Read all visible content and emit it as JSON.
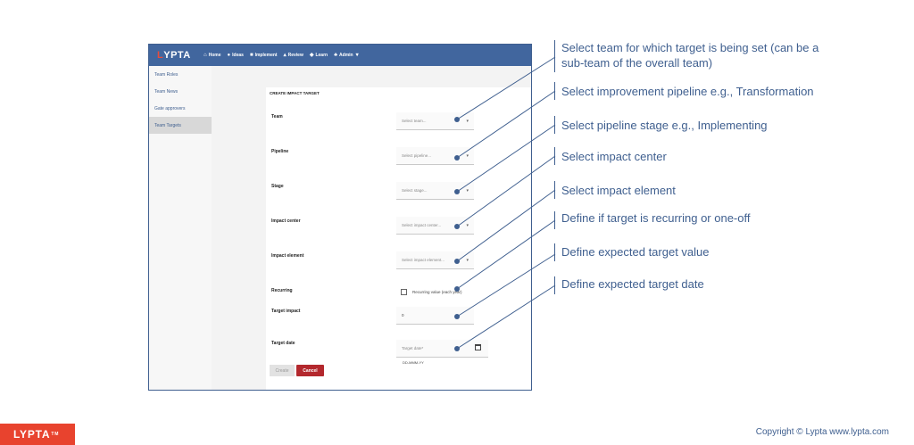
{
  "app": {
    "logo_text": "LYPTA",
    "nav": [
      {
        "label": "Home",
        "icon": "home-icon"
      },
      {
        "label": "Ideas",
        "icon": "lightbulb-icon"
      },
      {
        "label": "Implement",
        "icon": "implement-icon"
      },
      {
        "label": "Review",
        "icon": "review-icon"
      },
      {
        "label": "Learn",
        "icon": "learn-icon"
      },
      {
        "label": "Admin",
        "icon": "admin-icon"
      }
    ],
    "sidebar": [
      "Team Roles",
      "Team News",
      "Gate approvers",
      "Team Targets"
    ],
    "active_sidebar": "Team Targets",
    "form": {
      "title": "CREATE IMPACT TARGET",
      "team_label": "Team",
      "team_placeholder": "Select team...",
      "pipeline_label": "Pipeline",
      "pipeline_placeholder": "Select pipeline...",
      "stage_label": "Stage",
      "stage_placeholder": "Select stage...",
      "impact_center_label": "Impact center",
      "impact_center_placeholder": "Select impact center...",
      "impact_element_label": "Impact element",
      "impact_element_placeholder": "Select impact element...",
      "recurring_label": "Recurring",
      "recurring_checkbox_label": "Recurring value (each year)",
      "target_impact_label": "Target impact",
      "target_impact_value": "0",
      "target_date_label": "Target date",
      "target_date_placeholder": "Target date*",
      "target_date_hint": "DD-MMM-YY",
      "create_label": "Create",
      "cancel_label": "Cancel"
    }
  },
  "annotations": [
    {
      "lines": [
        "Select team for which target is being set (can be a",
        "sub-team of the overall team)"
      ]
    },
    {
      "lines": [
        "Select improvement pipeline e.g., Transformation"
      ]
    },
    {
      "lines": [
        "Select pipeline stage e.g., Implementing"
      ]
    },
    {
      "lines": [
        "Select impact center"
      ]
    },
    {
      "lines": [
        "Select impact element"
      ]
    },
    {
      "lines": [
        "Define if target is recurring or one-off"
      ]
    },
    {
      "lines": [
        "Define expected target value"
      ]
    },
    {
      "lines": [
        "Define expected target date"
      ]
    }
  ],
  "footer": {
    "logo_text": "LYPTA",
    "logo_mark": "TM",
    "copyright": "Copyright © Lypta   www.lypta.com"
  },
  "colors": {
    "brand_blue": "#41669e",
    "annotation_blue": "#3f5f8f",
    "brand_red": "#e8432e",
    "cancel_red": "#b3282d"
  }
}
